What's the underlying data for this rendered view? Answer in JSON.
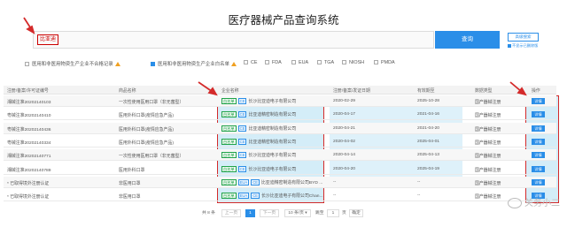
{
  "title": "医疗器械产品查询系统",
  "search": {
    "value": "比亚迪",
    "button": "查询",
    "advanced": "高级搜索",
    "advanced_option": "不显示已删除版"
  },
  "filters": [
    {
      "label": "医用和非医用物资生产企业不合格记录",
      "checked": false,
      "warn": true
    },
    {
      "label": "医用和非医用物资生产企业白名单",
      "checked": true,
      "warn": true
    },
    {
      "label": "CE",
      "checked": false
    },
    {
      "label": "FDA",
      "checked": false
    },
    {
      "label": "EUA",
      "checked": false
    },
    {
      "label": "TGA",
      "checked": false
    },
    {
      "label": "NIOSH",
      "checked": false
    },
    {
      "label": "PMDA",
      "checked": false
    }
  ],
  "table": {
    "headers": [
      "注册/备案/许可证编号",
      "商品名称",
      "企业名称",
      "注册/备案/发证日期",
      "有效期至",
      "数据类型",
      "操作"
    ],
    "rows": [
      {
        "reg": "湘械注准20202140103",
        "product": "一次性使用医用口罩（非无菌型）",
        "tags": [
          "白名单",
          "CE"
        ],
        "company": "长沙比亚迪电子有限公司",
        "date": "2020-02-29",
        "expire": "2025-10-28",
        "type": "国产器械注册",
        "action": "详情"
      },
      {
        "reg": "粤械注准20202140410",
        "product": "医用外科口罩(疫情应急产品)",
        "tags": [
          "白名单",
          "CE"
        ],
        "company": "比亚迪精密制造有限公司",
        "date": "2020-04-17",
        "expire": "2021-04-16",
        "type": "国产器械注册",
        "action": "详情"
      },
      {
        "reg": "粤械注准20202140436",
        "product": "医用外科口罩(疫情应急产品)",
        "tags": [
          "白名单",
          "CE"
        ],
        "company": "比亚迪精密制造有限公司",
        "date": "2020-04-21",
        "expire": "2021-04-20",
        "type": "国产器械注册",
        "action": "详情"
      },
      {
        "reg": "粤械注准20202140334",
        "product": "医用外科口罩(疫情应急产品)",
        "tags": [
          "白名单",
          "CE"
        ],
        "company": "比亚迪精密制造有限公司",
        "date": "2020-04-02",
        "expire": "2025-04-01",
        "type": "国产器械注册",
        "action": "详情"
      },
      {
        "reg": "湘械注准20202140771",
        "product": "一次性使用医用口罩（非无菌型）",
        "tags": [
          "白名单",
          "CE"
        ],
        "company": "长沙比亚迪电子有限公司",
        "date": "2020-04-14",
        "expire": "2025-04-13",
        "type": "国产器械注册",
        "action": "详情"
      },
      {
        "reg": "湘械注准20202140789",
        "product": "医用外科口罩",
        "tags": [
          "白名单",
          "CE"
        ],
        "company": "长沙比亚迪电子有限公司",
        "date": "2020-04-20",
        "expire": "2025-04-19",
        "type": "国产器械注册",
        "action": "详情"
      },
      {
        "reg": "* 已取得境外注册认证",
        "product": "非医用口罩",
        "tags": [
          "白名单",
          "EUA",
          "CE"
        ],
        "company": "比亚迪精密制造有限公司BYD ...",
        "date": "--",
        "expire": "--",
        "type": "国产器械注册",
        "action": "详情"
      },
      {
        "reg": "* 已取得境外注册认证",
        "product": "非医用口罩",
        "tags": [
          "白名单",
          "EUA",
          "CE"
        ],
        "company": "长沙比亚迪电子有限公司Chan...",
        "date": "--",
        "expire": "--",
        "type": "国产器械注册",
        "action": "详情"
      }
    ]
  },
  "pagination": {
    "total": "共 8 条",
    "prev": "上一页",
    "current": "1",
    "next": "下一页",
    "page_size": "10 条/页",
    "goto_label": "跳至",
    "goto_value": "1",
    "goto_unit": "页",
    "confirm": "确定"
  },
  "watermark": "关务小二",
  "colors": {
    "accent": "#2a8ee8",
    "highlight_border": "#d42a2a",
    "tag_green": "#21a34a"
  }
}
